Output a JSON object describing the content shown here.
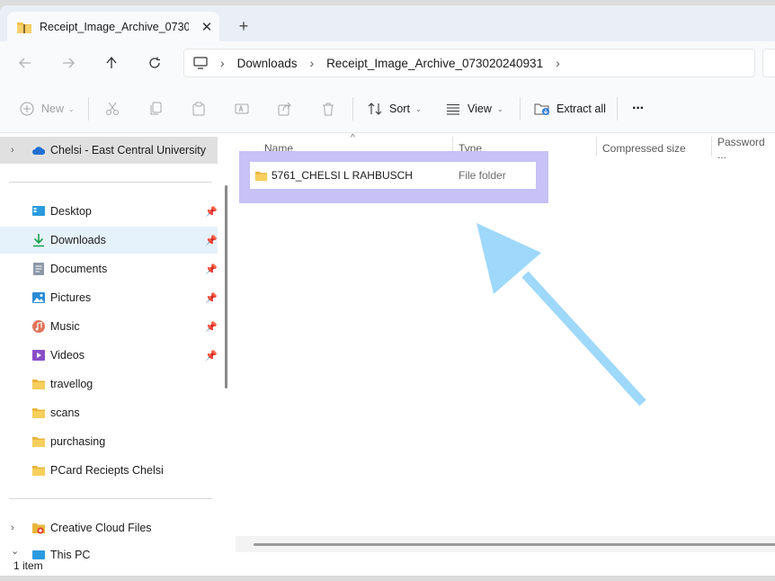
{
  "tab": {
    "title": "Receipt_Image_Archive_073020240931",
    "close_label": "✕",
    "new_tab_label": "+"
  },
  "address": {
    "segments": [
      "Downloads",
      "Receipt_Image_Archive_073020240931"
    ]
  },
  "toolbar": {
    "new_label": "New",
    "sort_label": "Sort",
    "view_label": "View",
    "extract_label": "Extract all",
    "more_label": "···"
  },
  "sidebar": {
    "cloud": "Chelsi - East Central University",
    "quick": [
      {
        "label": "Desktop",
        "icon": "desktop-icon"
      },
      {
        "label": "Downloads",
        "icon": "download-icon"
      },
      {
        "label": "Documents",
        "icon": "document-icon"
      },
      {
        "label": "Pictures",
        "icon": "pictures-icon"
      },
      {
        "label": "Music",
        "icon": "music-icon"
      },
      {
        "label": "Videos",
        "icon": "videos-icon"
      },
      {
        "label": "travellog",
        "icon": "folder-icon"
      },
      {
        "label": "scans",
        "icon": "folder-icon"
      },
      {
        "label": "purchasing",
        "icon": "folder-icon"
      },
      {
        "label": "PCard Reciepts Chelsi",
        "icon": "folder-icon"
      }
    ],
    "creative_cloud": "Creative Cloud Files",
    "this_pc": "This PC"
  },
  "columns": {
    "name": "Name",
    "type": "Type",
    "compressed_size": "Compressed size",
    "password": "Password ..."
  },
  "files": [
    {
      "name": "5761_CHELSI L RAHBUSCH",
      "type": "File folder"
    }
  ],
  "status": {
    "count": "1 item"
  },
  "colors": {
    "highlight": "#c7c1f7",
    "arrow": "#9ed8fb",
    "selection": "#e5f1fb",
    "folder": "#f2c24b"
  }
}
